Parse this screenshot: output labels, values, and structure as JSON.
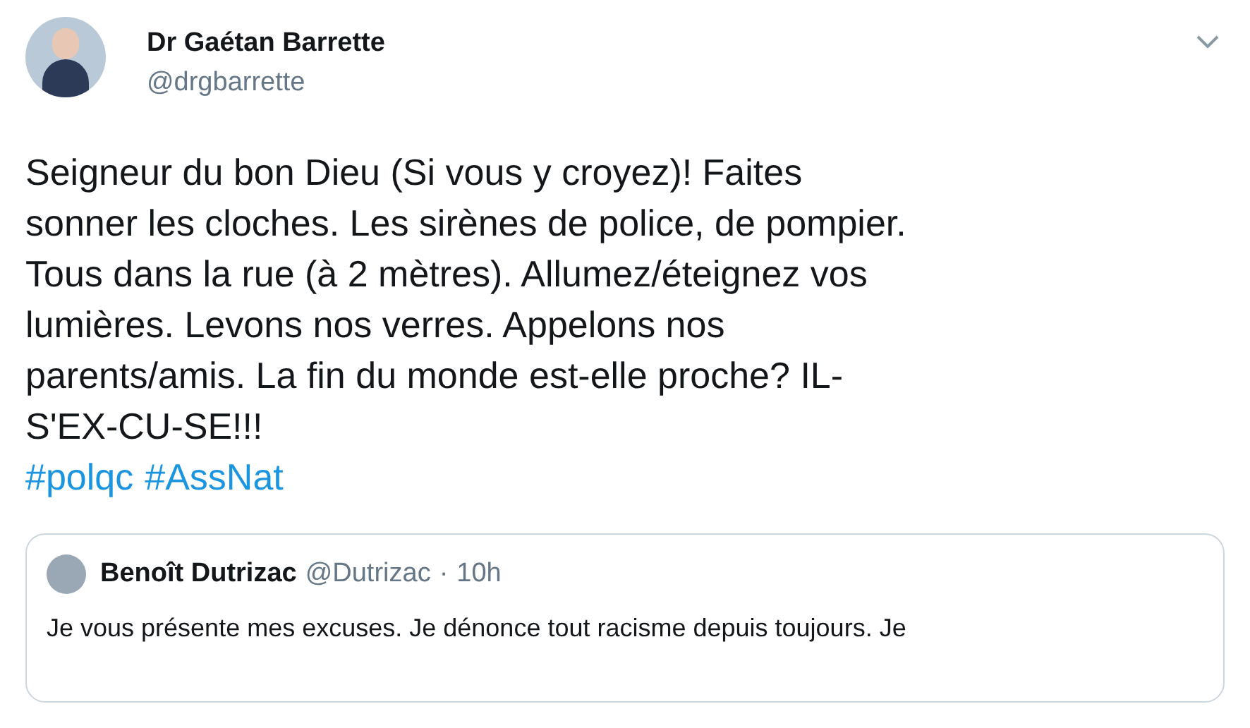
{
  "tweet": {
    "author": {
      "name": "Dr Gaétan Barrette",
      "handle": "@drgbarrette"
    },
    "text_lines": [
      "Seigneur du bon Dieu (Si vous y croyez)! Faites",
      "sonner les cloches. Les sirènes de police, de pompier.",
      "Tous dans la rue (à 2 mètres). Allumez/éteignez vos",
      "lumières. Levons nos verres. Appelons nos",
      "parents/amis. La fin du monde est-elle proche? IL-",
      "S'EX-CU-SE!!!"
    ],
    "hashtags": [
      "#polqc",
      "#AssNat"
    ],
    "quoted_tweet": {
      "author": {
        "name": "Benoît Dutrizac",
        "handle": "@Dutrizac"
      },
      "separator": "·",
      "time": "10h",
      "text": "Je vous présente mes excuses. Je dénonce tout racisme depuis toujours. Je"
    }
  }
}
